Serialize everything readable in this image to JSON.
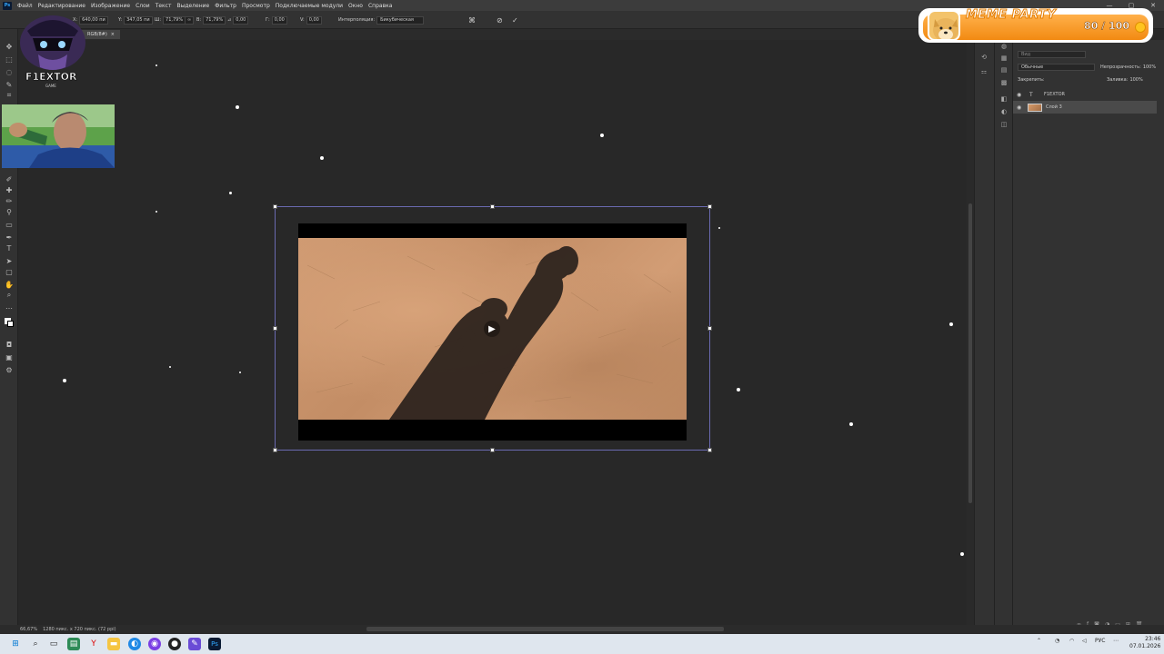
{
  "app": {
    "icon_label": "Ps"
  },
  "menu": [
    "Файл",
    "Редактирование",
    "Изображение",
    "Слои",
    "Текст",
    "Выделение",
    "Фильтр",
    "Просмотр",
    "Подключаемые модули",
    "Окно",
    "Справка"
  ],
  "options": {
    "x_label": "X:",
    "x_value": "640,00 пи",
    "y_label": "Y:",
    "y_value": "347,05 пи",
    "w_label": "Ш:",
    "w_value": "71,79%",
    "link_icon": "link-icon",
    "h_label": "В:",
    "h_value": "71,79%",
    "angle_label": "⊿",
    "angle_value": "0,00",
    "hskew_label": "Г:",
    "hskew_value": "0,00",
    "vskew_label": "V:",
    "vskew_value": "0,00",
    "interp_label": "Интерполяция:",
    "interp_value": "Бикубическая"
  },
  "document_tab": {
    "label": "RGB/8#)",
    "close_icon": "×"
  },
  "canvas": {
    "selected_layer_preview": "sand-shadow-photo"
  },
  "layers_panel": {
    "search_placeholder": "Вид",
    "blend_mode": "Обычные",
    "opacity_label": "Непрозрачность:",
    "opacity_value": "100%",
    "lock_label": "Закрепить:",
    "fill_label": "Заливка:",
    "fill_value": "100%",
    "layers": [
      {
        "name": "F1EXTOR",
        "type": "text",
        "type_icon": "T",
        "visible": true
      },
      {
        "name": "Слой 3",
        "type": "image",
        "visible": true,
        "selected": true
      }
    ]
  },
  "status": {
    "zoom": "66,67%",
    "doc_info": "1280 пикс. x 720 пикс. (72 ppi)"
  },
  "overlay": {
    "logo_text": "F1EXTOR",
    "logo_sub": "GAME",
    "meme_title": "MEME PARTY",
    "meme_count": "80 / 100"
  },
  "taskbar": {
    "lang": "РУС",
    "time": "23:46",
    "date": "07.01.2026"
  },
  "colors": {
    "accent": "#31a8ff",
    "bbox": "#6a6ab0",
    "meme_orange": "#f28a12"
  }
}
